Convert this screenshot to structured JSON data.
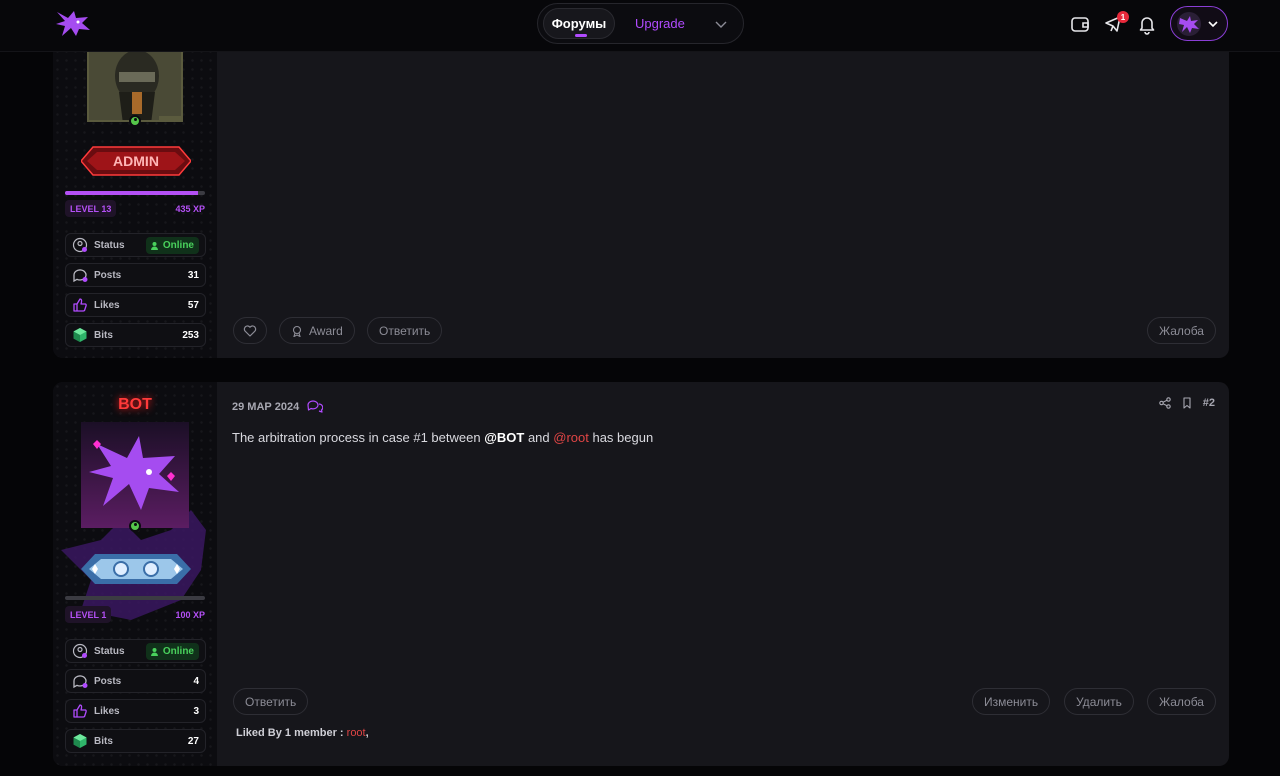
{
  "header": {
    "tabs": [
      {
        "label": "Форумы",
        "active": true
      },
      {
        "label": "Upgrade",
        "active": false
      }
    ],
    "notification_badge": "1",
    "icons": [
      "wallet-icon",
      "megaphone-icon",
      "bell-icon",
      "dragon-logo-icon",
      "chevron-down-icon"
    ]
  },
  "colors": {
    "accent": "#b14bff",
    "danger": "#e8293b",
    "online": "#49d15c",
    "mention": "#e04545"
  },
  "posts": [
    {
      "author_banner": "ADMIN",
      "level": "LEVEL 13",
      "xp": "435 XP",
      "xp_progress": 0.95,
      "stats": {
        "status_label": "Status",
        "status_value": "Online",
        "posts_label": "Posts",
        "posts_value": "31",
        "likes_label": "Likes",
        "likes_value": "57",
        "bits_label": "Bits",
        "bits_value": "253"
      },
      "actions": {
        "award": "Award",
        "reply": "Ответить",
        "report": "Жалоба"
      }
    },
    {
      "author_name": "BOT",
      "date": "29 МАР 2024",
      "post_number": "#2",
      "message": {
        "before": "The arbitration process in case #1 between ",
        "mention1": "@BOT",
        "middle": " and ",
        "mention2": "@root",
        "after": " has begun"
      },
      "level": "LEVEL 1",
      "xp": "100 XP",
      "xp_progress": 0.0,
      "stats": {
        "status_label": "Status",
        "status_value": "Online",
        "posts_label": "Posts",
        "posts_value": "4",
        "likes_label": "Likes",
        "likes_value": "3",
        "bits_label": "Bits",
        "bits_value": "27"
      },
      "actions": {
        "reply": "Ответить",
        "edit": "Изменить",
        "delete": "Удалить",
        "report": "Жалоба"
      },
      "liked_by": {
        "label": "Liked By 1 member : ",
        "user": "root",
        "suffix": ","
      }
    }
  ]
}
